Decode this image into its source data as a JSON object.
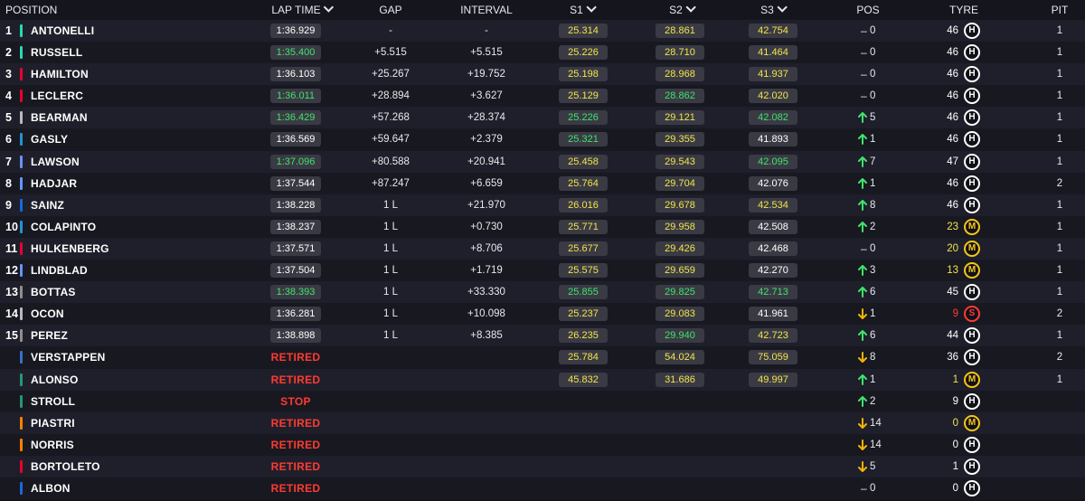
{
  "header": {
    "position": "POSITION",
    "lap_time": "LAP TIME",
    "gap": "GAP",
    "interval": "INTERVAL",
    "s1": "S1",
    "s2": "S2",
    "s3": "S3",
    "pos": "POS",
    "tyre": "TYRE",
    "pit": "PIT"
  },
  "colors": {
    "purple": "#c38cff",
    "green": "#3fe36b",
    "yellow": "#f2e54a",
    "white": "#ffffff",
    "retired_red": "#ff3b30",
    "arrow_up": "#3fe36b",
    "arrow_down": "#f5b400",
    "tyre_hard": "#ffffff",
    "tyre_medium": "#f5c518",
    "tyre_soft": "#ff3b30"
  },
  "rows": [
    {
      "pos": "1",
      "name": "ANTONELLI",
      "team": "#27d7b7",
      "lap": "1:36.929",
      "lapc": "white",
      "gap": "-",
      "int": "-",
      "s1": "25.314",
      "s1c": "yellow",
      "s2": "28.861",
      "s2c": "yellow",
      "s3": "42.754",
      "s3c": "yellow",
      "dir": "none",
      "chg": "0",
      "age": "46",
      "agec": "white",
      "tyre": "H",
      "pit": "1"
    },
    {
      "pos": "2",
      "name": "RUSSELL",
      "team": "#27d7b7",
      "lap": "1:35.400",
      "lapc": "green",
      "gap": "+5.515",
      "int": "+5.515",
      "s1": "25.226",
      "s1c": "yellow",
      "s2": "28.710",
      "s2c": "yellow",
      "s3": "41.464",
      "s3c": "yellow",
      "dir": "none",
      "chg": "0",
      "age": "46",
      "agec": "white",
      "tyre": "H",
      "pit": "1"
    },
    {
      "pos": "3",
      "name": "HAMILTON",
      "team": "#e8002d",
      "lap": "1:36.103",
      "lapc": "white",
      "gap": "+25.267",
      "int": "+19.752",
      "s1": "25.198",
      "s1c": "yellow",
      "s2": "28.968",
      "s2c": "yellow",
      "s3": "41.937",
      "s3c": "yellow",
      "dir": "none",
      "chg": "0",
      "age": "46",
      "agec": "white",
      "tyre": "H",
      "pit": "1"
    },
    {
      "pos": "4",
      "name": "LECLERC",
      "team": "#e8002d",
      "lap": "1:36.011",
      "lapc": "green",
      "gap": "+28.894",
      "int": "+3.627",
      "s1": "25.129",
      "s1c": "yellow",
      "s2": "28.862",
      "s2c": "green",
      "s3": "42.020",
      "s3c": "yellow",
      "dir": "none",
      "chg": "0",
      "age": "46",
      "agec": "white",
      "tyre": "H",
      "pit": "1"
    },
    {
      "pos": "5",
      "name": "BEARMAN",
      "team": "#b6babd",
      "lap": "1:36.429",
      "lapc": "green",
      "gap": "+57.268",
      "int": "+28.374",
      "s1": "25.226",
      "s1c": "green",
      "s2": "29.121",
      "s2c": "yellow",
      "s3": "42.082",
      "s3c": "green",
      "dir": "up",
      "chg": "5",
      "age": "46",
      "agec": "white",
      "tyre": "H",
      "pit": "1"
    },
    {
      "pos": "6",
      "name": "GASLY",
      "team": "#2293d1",
      "lap": "1:36.569",
      "lapc": "white",
      "gap": "+59.647",
      "int": "+2.379",
      "s1": "25.321",
      "s1c": "green",
      "s2": "29.355",
      "s2c": "yellow",
      "s3": "41.893",
      "s3c": "white",
      "dir": "up",
      "chg": "1",
      "age": "46",
      "agec": "white",
      "tyre": "H",
      "pit": "1"
    },
    {
      "pos": "7",
      "name": "LAWSON",
      "team": "#6692ff",
      "lap": "1:37.096",
      "lapc": "green",
      "gap": "+80.588",
      "int": "+20.941",
      "s1": "25.458",
      "s1c": "yellow",
      "s2": "29.543",
      "s2c": "yellow",
      "s3": "42.095",
      "s3c": "green",
      "dir": "up",
      "chg": "7",
      "age": "47",
      "agec": "white",
      "tyre": "H",
      "pit": "1"
    },
    {
      "pos": "8",
      "name": "HADJAR",
      "team": "#6692ff",
      "lap": "1:37.544",
      "lapc": "white",
      "gap": "+87.247",
      "int": "+6.659",
      "s1": "25.764",
      "s1c": "yellow",
      "s2": "29.704",
      "s2c": "yellow",
      "s3": "42.076",
      "s3c": "white",
      "dir": "up",
      "chg": "1",
      "age": "46",
      "agec": "white",
      "tyre": "H",
      "pit": "2"
    },
    {
      "pos": "9",
      "name": "SAINZ",
      "team": "#1868db",
      "lap": "1:38.228",
      "lapc": "white",
      "gap": "1 L",
      "int": "+21.970",
      "s1": "26.016",
      "s1c": "yellow",
      "s2": "29.678",
      "s2c": "yellow",
      "s3": "42.534",
      "s3c": "yellow",
      "dir": "up",
      "chg": "8",
      "age": "46",
      "agec": "white",
      "tyre": "H",
      "pit": "1"
    },
    {
      "pos": "10",
      "name": "COLAPINTO",
      "team": "#2293d1",
      "lap": "1:38.237",
      "lapc": "white",
      "gap": "1 L",
      "int": "+0.730",
      "s1": "25.771",
      "s1c": "yellow",
      "s2": "29.958",
      "s2c": "yellow",
      "s3": "42.508",
      "s3c": "white",
      "dir": "up",
      "chg": "2",
      "age": "23",
      "agec": "yellow",
      "tyre": "M",
      "pit": "1"
    },
    {
      "pos": "11",
      "name": "HULKENBERG",
      "team": "#e8002d",
      "lap": "1:37.571",
      "lapc": "white",
      "gap": "1 L",
      "int": "+8.706",
      "s1": "25.677",
      "s1c": "yellow",
      "s2": "29.426",
      "s2c": "yellow",
      "s3": "42.468",
      "s3c": "white",
      "dir": "none",
      "chg": "0",
      "age": "20",
      "agec": "yellow",
      "tyre": "M",
      "pit": "1"
    },
    {
      "pos": "12",
      "name": "LINDBLAD",
      "team": "#6692ff",
      "lap": "1:37.504",
      "lapc": "white",
      "gap": "1 L",
      "int": "+1.719",
      "s1": "25.575",
      "s1c": "yellow",
      "s2": "29.659",
      "s2c": "yellow",
      "s3": "42.270",
      "s3c": "white",
      "dir": "up",
      "chg": "3",
      "age": "13",
      "agec": "yellow",
      "tyre": "M",
      "pit": "1"
    },
    {
      "pos": "13",
      "name": "BOTTAS",
      "team": "#8e8e8e",
      "lap": "1:38.393",
      "lapc": "green",
      "gap": "1 L",
      "int": "+33.330",
      "s1": "25.855",
      "s1c": "green",
      "s2": "29.825",
      "s2c": "green",
      "s3": "42.713",
      "s3c": "green",
      "dir": "up",
      "chg": "6",
      "age": "45",
      "agec": "white",
      "tyre": "H",
      "pit": "1"
    },
    {
      "pos": "14",
      "name": "OCON",
      "team": "#b6babd",
      "lap": "1:36.281",
      "lapc": "white",
      "gap": "1 L",
      "int": "+10.098",
      "s1": "25.237",
      "s1c": "yellow",
      "s2": "29.083",
      "s2c": "yellow",
      "s3": "41.961",
      "s3c": "white",
      "dir": "down",
      "chg": "1",
      "age": "9",
      "agec": "red",
      "tyre": "S",
      "pit": "2"
    },
    {
      "pos": "15",
      "name": "PEREZ",
      "team": "#8e8e8e",
      "lap": "1:38.898",
      "lapc": "white",
      "gap": "1 L",
      "int": "+8.385",
      "s1": "26.235",
      "s1c": "yellow",
      "s2": "29.940",
      "s2c": "green",
      "s3": "42.723",
      "s3c": "yellow",
      "dir": "up",
      "chg": "6",
      "age": "44",
      "agec": "white",
      "tyre": "H",
      "pit": "1"
    },
    {
      "pos": "",
      "name": "VERSTAPPEN",
      "team": "#3671c6",
      "lap": "RETIRED",
      "lapc": "status",
      "gap": "",
      "int": "",
      "s1": "25.784",
      "s1c": "yellow",
      "s2": "54.024",
      "s2c": "yellow",
      "s3": "75.059",
      "s3c": "yellow",
      "dir": "down",
      "chg": "8",
      "age": "36",
      "agec": "white",
      "tyre": "H",
      "pit": "2"
    },
    {
      "pos": "",
      "name": "ALONSO",
      "team": "#229971",
      "lap": "RETIRED",
      "lapc": "status",
      "gap": "",
      "int": "",
      "s1": "45.832",
      "s1c": "yellow",
      "s2": "31.686",
      "s2c": "yellow",
      "s3": "49.997",
      "s3c": "yellow",
      "dir": "up",
      "chg": "1",
      "age": "1",
      "agec": "yellow",
      "tyre": "M",
      "pit": "1"
    },
    {
      "pos": "",
      "name": "STROLL",
      "team": "#229971",
      "lap": "STOP",
      "lapc": "status",
      "gap": "",
      "int": "",
      "s1": "",
      "s1c": "",
      "s2": "",
      "s2c": "",
      "s3": "",
      "s3c": "",
      "dir": "up",
      "chg": "2",
      "age": "9",
      "agec": "white",
      "tyre": "H",
      "pit": ""
    },
    {
      "pos": "",
      "name": "PIASTRI",
      "team": "#ff8000",
      "lap": "RETIRED",
      "lapc": "status",
      "gap": "",
      "int": "",
      "s1": "",
      "s1c": "",
      "s2": "",
      "s2c": "",
      "s3": "",
      "s3c": "",
      "dir": "down",
      "chg": "14",
      "age": "0",
      "agec": "yellow",
      "tyre": "M",
      "pit": ""
    },
    {
      "pos": "",
      "name": "NORRIS",
      "team": "#ff8000",
      "lap": "RETIRED",
      "lapc": "status",
      "gap": "",
      "int": "",
      "s1": "",
      "s1c": "",
      "s2": "",
      "s2c": "",
      "s3": "",
      "s3c": "",
      "dir": "down",
      "chg": "14",
      "age": "0",
      "agec": "white",
      "tyre": "H",
      "pit": ""
    },
    {
      "pos": "",
      "name": "BORTOLETO",
      "team": "#e8002d",
      "lap": "RETIRED",
      "lapc": "status",
      "gap": "",
      "int": "",
      "s1": "",
      "s1c": "",
      "s2": "",
      "s2c": "",
      "s3": "",
      "s3c": "",
      "dir": "down",
      "chg": "5",
      "age": "1",
      "agec": "white",
      "tyre": "H",
      "pit": ""
    },
    {
      "pos": "",
      "name": "ALBON",
      "team": "#1868db",
      "lap": "RETIRED",
      "lapc": "status",
      "gap": "",
      "int": "",
      "s1": "",
      "s1c": "",
      "s2": "",
      "s2c": "",
      "s3": "",
      "s3c": "",
      "dir": "none",
      "chg": "0",
      "age": "0",
      "agec": "white",
      "tyre": "H",
      "pit": ""
    }
  ]
}
